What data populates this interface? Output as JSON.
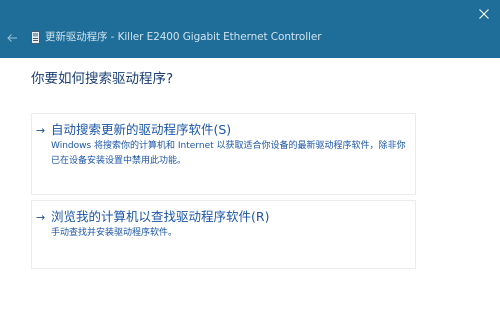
{
  "header": {
    "title": "更新驱动程序 - Killer E2400 Gigabit Ethernet Controller",
    "back_icon": "arrow-left-icon",
    "device_icon": "device-icon",
    "close_icon": "close-icon",
    "background_color": "#1f6e99"
  },
  "main": {
    "title": "你要如何搜索驱动程序?",
    "options": [
      {
        "arrow": "→",
        "title": "自动搜索更新的驱动程序软件(S)",
        "description": "Windows 将搜索你的计算机和 Internet 以获取适合你设备的最新驱动程序软件，除非你已在设备安装设置中禁用此功能。"
      },
      {
        "arrow": "→",
        "title": "浏览我的计算机以查找驱动程序软件(R)",
        "description": "手动查找并安装驱动程序软件。"
      }
    ]
  }
}
